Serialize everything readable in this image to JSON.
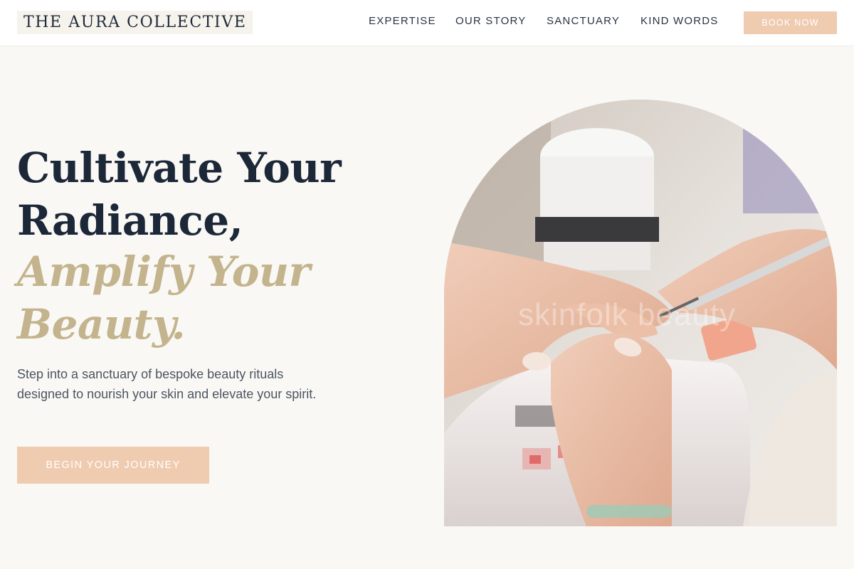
{
  "header": {
    "logo": "THE AURA COLLECTIVE",
    "nav": [
      "EXPERTISE",
      "OUR STORY",
      "SANCTUARY",
      "KIND WORDS"
    ],
    "book_label": "BOOK NOW"
  },
  "hero": {
    "line1": "Cultivate Your",
    "line2": "Radiance,",
    "line3": "Amplify Your",
    "line4": "Beauty.",
    "description": "Step into a sanctuary of bespoke beauty rituals designed to nourish your skin and elevate your spirit.",
    "cta_label": "BEGIN YOUR JOURNEY"
  },
  "image": {
    "watermark": "skinfolk beauty"
  },
  "colors": {
    "accent": "#efcbb0",
    "gold": "#c4b48d",
    "navy": "#1c2738",
    "background": "#f9f8f5"
  }
}
